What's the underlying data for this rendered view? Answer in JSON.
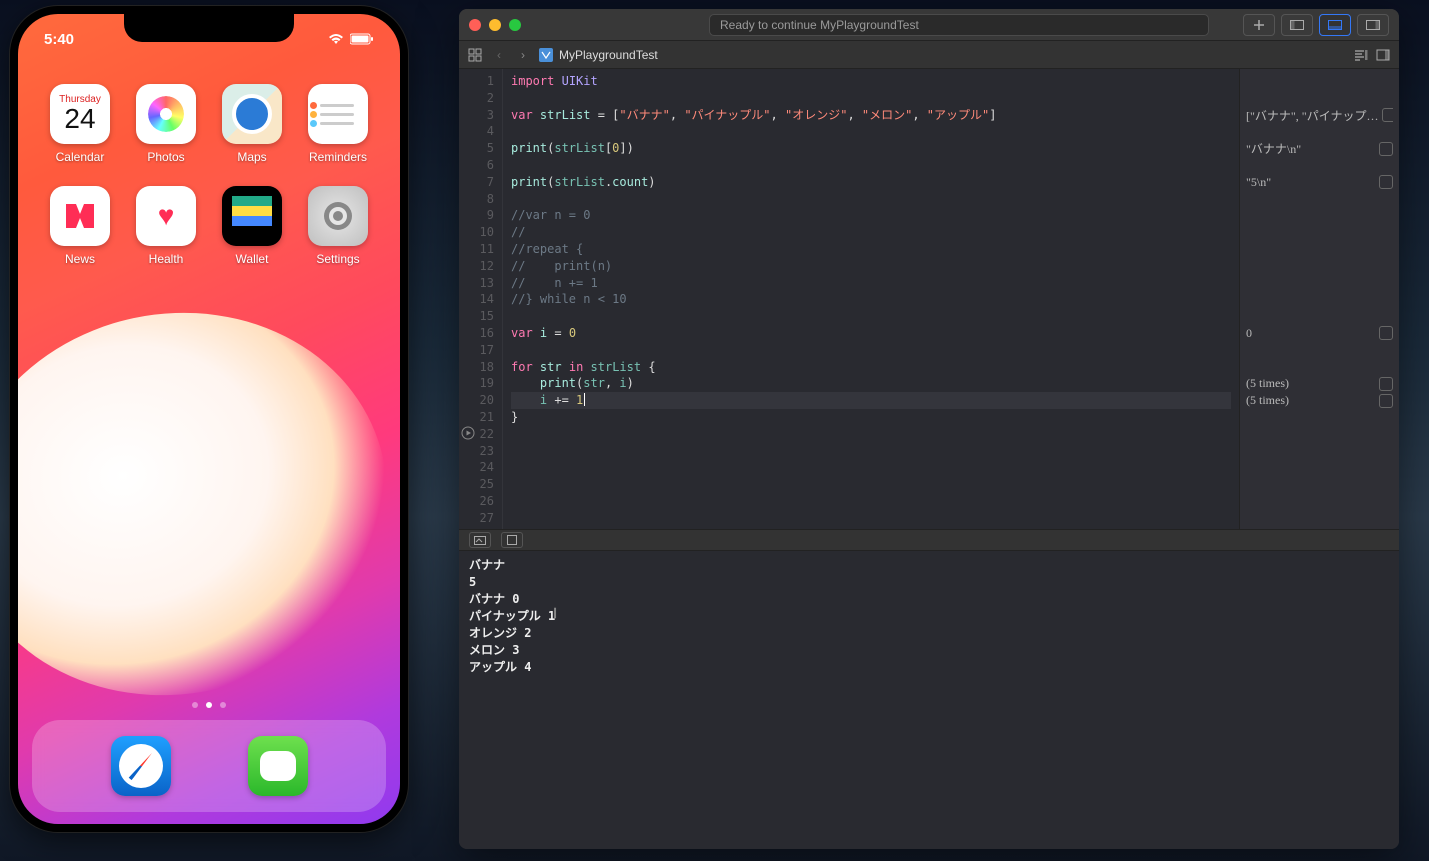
{
  "simulator": {
    "time": "5:40",
    "apps": [
      {
        "id": "calendar",
        "label": "Calendar",
        "dow": "Thursday",
        "day": "24"
      },
      {
        "id": "photos",
        "label": "Photos"
      },
      {
        "id": "maps",
        "label": "Maps"
      },
      {
        "id": "reminders",
        "label": "Reminders"
      },
      {
        "id": "news",
        "label": "News"
      },
      {
        "id": "health",
        "label": "Health"
      },
      {
        "id": "wallet",
        "label": "Wallet"
      },
      {
        "id": "settings",
        "label": "Settings"
      }
    ],
    "dock": [
      {
        "id": "safari",
        "label": "Safari"
      },
      {
        "id": "messages",
        "label": "Messages"
      }
    ],
    "page_count": 3,
    "page_active": 1
  },
  "xcode": {
    "status_text": "Ready to continue MyPlaygroundTest",
    "file_name": "MyPlaygroundTest",
    "line_count": 27,
    "current_line": 20,
    "play_line": 22,
    "code_lines": [
      {
        "html": "<span class='k'>import</span> <span class='ty'>UIKit</span>"
      },
      {
        "html": ""
      },
      {
        "html": "<span class='k'>var</span> <span class='id'>strList</span> = [<span class='str'>\"バナナ\"</span>, <span class='str'>\"パイナップル\"</span>, <span class='str'>\"オレンジ\"</span>, <span class='str'>\"メロン\"</span>, <span class='str'>\"アップル\"</span>]"
      },
      {
        "html": ""
      },
      {
        "html": "<span class='fn'>print</span>(<span class='id2'>strList</span>[<span class='num'>0</span>])"
      },
      {
        "html": ""
      },
      {
        "html": "<span class='fn'>print</span>(<span class='id2'>strList</span>.<span class='id'>count</span>)"
      },
      {
        "html": ""
      },
      {
        "html": "<span class='cm'>//var n = 0</span>"
      },
      {
        "html": "<span class='cm'>//</span>"
      },
      {
        "html": "<span class='cm'>//repeat {</span>"
      },
      {
        "html": "<span class='cm'>//    print(n)</span>"
      },
      {
        "html": "<span class='cm'>//    n += 1</span>"
      },
      {
        "html": "<span class='cm'>//} while n &lt; 10</span>"
      },
      {
        "html": ""
      },
      {
        "html": "<span class='k'>var</span> <span class='id'>i</span> = <span class='num'>0</span>"
      },
      {
        "html": ""
      },
      {
        "html": "<span class='k'>for</span> <span class='id'>str</span> <span class='k'>in</span> <span class='id2'>strList</span> {"
      },
      {
        "html": "    <span class='fn'>print</span>(<span class='id2'>str</span>, <span class='id2'>i</span>)"
      },
      {
        "html": "    <span class='id2'>i</span> += <span class='num'>1</span><span class='caret'></span>",
        "hl": true
      },
      {
        "html": "}"
      },
      {
        "html": ""
      },
      {
        "html": ""
      },
      {
        "html": ""
      },
      {
        "html": ""
      },
      {
        "html": ""
      },
      {
        "html": ""
      }
    ],
    "results": [
      {
        "line": 3,
        "text": "[\"バナナ\", \"パイナップ…"
      },
      {
        "line": 5,
        "text": "\"バナナ\\n\""
      },
      {
        "line": 7,
        "text": "\"5\\n\""
      },
      {
        "line": 16,
        "text": "0"
      },
      {
        "line": 19,
        "text": "(5 times)"
      },
      {
        "line": 20,
        "text": "(5 times)"
      }
    ],
    "console_lines": [
      "バナナ",
      "5",
      "バナナ 0",
      "パイナップル 1",
      "オレンジ 2",
      "メロン 3",
      "アップル 4"
    ],
    "console_cursor_line": 3
  }
}
